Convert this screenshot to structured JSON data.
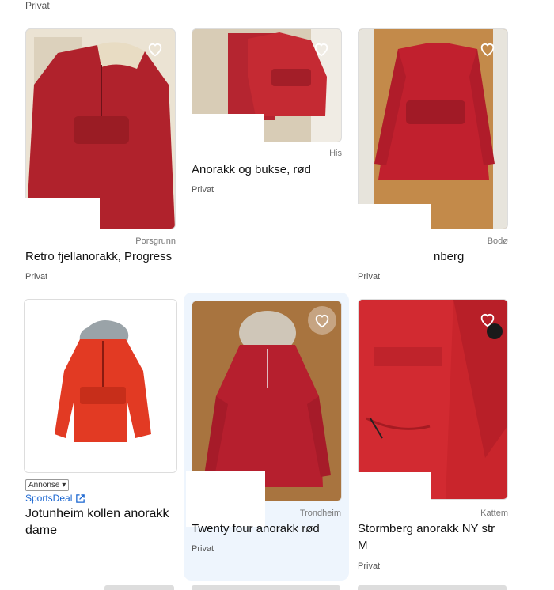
{
  "top_seller": "Privat",
  "listings": [
    {
      "id": "c1",
      "location": "Porsgrunn",
      "title": "Retro fjellanorakk, Progress",
      "seller": "Privat",
      "image": "red-jacket-closet"
    },
    {
      "id": "c2",
      "location": "His",
      "title": "Anorakk og bukse, rød",
      "seller": "Privat",
      "image": "red-jacket-pants"
    },
    {
      "id": "c3",
      "location": "Bodø",
      "title": "nberg",
      "seller": "Privat",
      "image": "red-jacket-door"
    },
    {
      "id": "c5",
      "location": "Trondheim",
      "title": "Twenty four anorakk rød",
      "seller": "Privat",
      "image": "red-jacket-fur"
    },
    {
      "id": "c6",
      "location": "Kattem",
      "title": "Stormberg anorakk NY str M",
      "seller": "Privat",
      "image": "red-jacket-closeup"
    }
  ],
  "ad": {
    "label": "Annonse ▾",
    "brand": "SportsDeal",
    "title": "Jotunheim kollen anorakk dame"
  },
  "icons": {
    "favorite": "heart-icon",
    "external": "external-link-icon"
  },
  "colors": {
    "jacket": "#b81f2a",
    "ad_jacket": "#e23a23",
    "brand_link": "#1a66d1",
    "highlight": "#eef5fd"
  }
}
